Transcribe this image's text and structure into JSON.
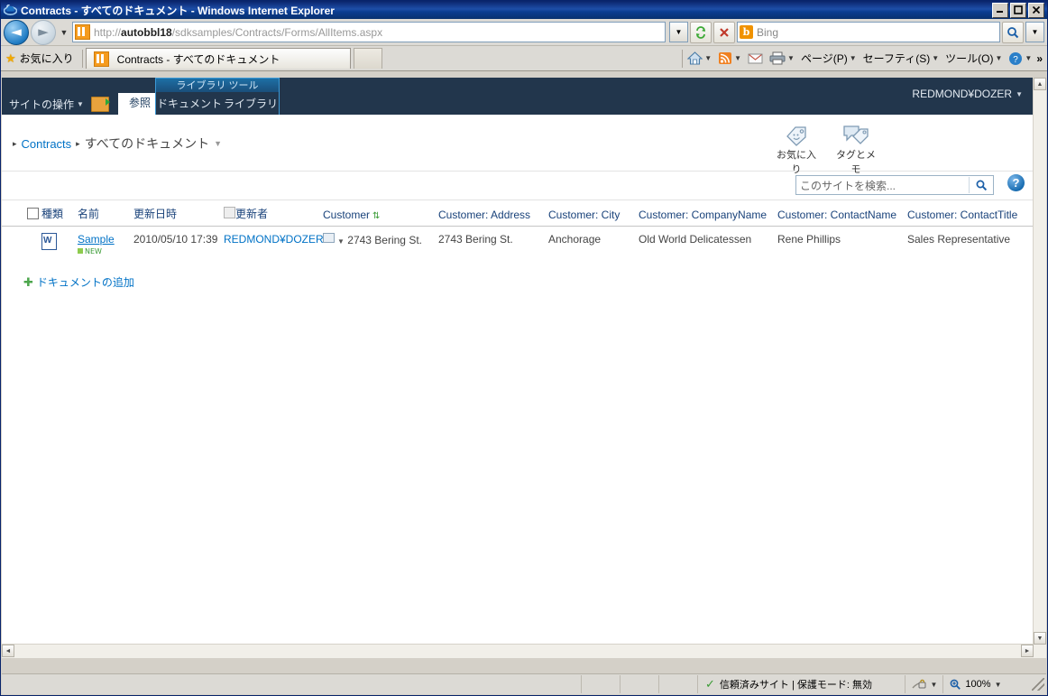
{
  "window": {
    "title": "Contracts - すべてのドキュメント - Windows Internet Explorer",
    "minimize": "_",
    "maximize": "❐",
    "close": "✕"
  },
  "address": {
    "back_icon": "◄",
    "forward_icon": "►",
    "history_caret": "▼",
    "url_prefix": "http://",
    "url_host": "autobbl18",
    "url_path": "/sdksamples/Contracts/Forms/AllItems.aspx",
    "url_dropdown": "▼",
    "refresh_icon": "↻",
    "stop_icon": "✕",
    "search_value": "Bing",
    "search_logo": "b",
    "search_go_icon": "🔍",
    "search_caret": "▼"
  },
  "favbar": {
    "favorites_label": "お気に入り",
    "tab_label": "Contracts - すべてのドキュメント",
    "commands": [
      {
        "name": "home-button",
        "icon": "⌂",
        "label": "",
        "caret": "▼"
      },
      {
        "name": "feeds-button",
        "icon": "◉",
        "label": "",
        "caret": "▼"
      },
      {
        "name": "mail-button",
        "icon": "✉",
        "label": "",
        "caret": ""
      },
      {
        "name": "print-button",
        "icon": "🖶",
        "label": "",
        "caret": "▼"
      },
      {
        "name": "page-menu",
        "icon": "",
        "label": "ページ(P)",
        "caret": "▼"
      },
      {
        "name": "safety-menu",
        "icon": "",
        "label": "セーフティ(S)",
        "caret": "▼"
      },
      {
        "name": "tools-menu",
        "icon": "",
        "label": "ツール(O)",
        "caret": "▼"
      },
      {
        "name": "help-menu",
        "icon": "?",
        "label": "",
        "caret": "▼"
      }
    ],
    "overflow": "»"
  },
  "ribbon": {
    "site_actions": "サイトの操作",
    "site_actions_caret": "▼",
    "browse_tab": "参照",
    "library_tools_title": "ライブラリ ツール",
    "documents_tab": "ドキュメント",
    "library_tab": "ライブラリ",
    "user": "REDMOND¥DOZER",
    "user_caret": "▼"
  },
  "breadcrumb": {
    "sep": "▸",
    "site": "Contracts",
    "current": "すべてのドキュメント",
    "caret": "▼"
  },
  "social": [
    {
      "name": "i-like-it",
      "label": "お気に入り"
    },
    {
      "name": "tags-and-notes",
      "label": "タグとメモ"
    }
  ],
  "search": {
    "placeholder": "このサイトを検索...",
    "go_icon": "🔍",
    "help_icon": "?"
  },
  "listview": {
    "headers": [
      {
        "name": "select-all",
        "label": ""
      },
      {
        "name": "type",
        "label": "種類"
      },
      {
        "name": "name",
        "label": "名前"
      },
      {
        "name": "modified",
        "label": "更新日時"
      },
      {
        "name": "modified-by",
        "label": "更新者"
      },
      {
        "name": "customer",
        "label": "Customer",
        "sorted": true
      },
      {
        "name": "customer-address",
        "label": "Customer: Address"
      },
      {
        "name": "customer-city",
        "label": "Customer: City"
      },
      {
        "name": "customer-companyname",
        "label": "Customer: CompanyName"
      },
      {
        "name": "customer-contactname",
        "label": "Customer: ContactName"
      },
      {
        "name": "customer-contacttitle",
        "label": "Customer: ContactTitle"
      }
    ],
    "rows": [
      {
        "type_icon": "word-document-icon",
        "name": "Sample",
        "new_badge": "NEW",
        "modified": "2010/05/10 17:39",
        "modified_by": "REDMOND¥DOZER",
        "customer": "2743 Bering St.",
        "customer_address": "2743 Bering St.",
        "customer_city": "Anchorage",
        "customer_companyname": "Old World Delicatessen",
        "customer_contactname": "Rene Phillips",
        "customer_contacttitle": "Sales Representative"
      }
    ],
    "add_document": "ドキュメントの追加"
  },
  "statusbar": {
    "zone": "信頼済みサイト | 保護モード: 無効",
    "zone_check": "✓",
    "privacy_caret": "▼",
    "zoom": "100%",
    "zoom_caret": "▼"
  },
  "scroll": {
    "up": "▲",
    "down": "▼",
    "left": "◄",
    "right": "►"
  }
}
